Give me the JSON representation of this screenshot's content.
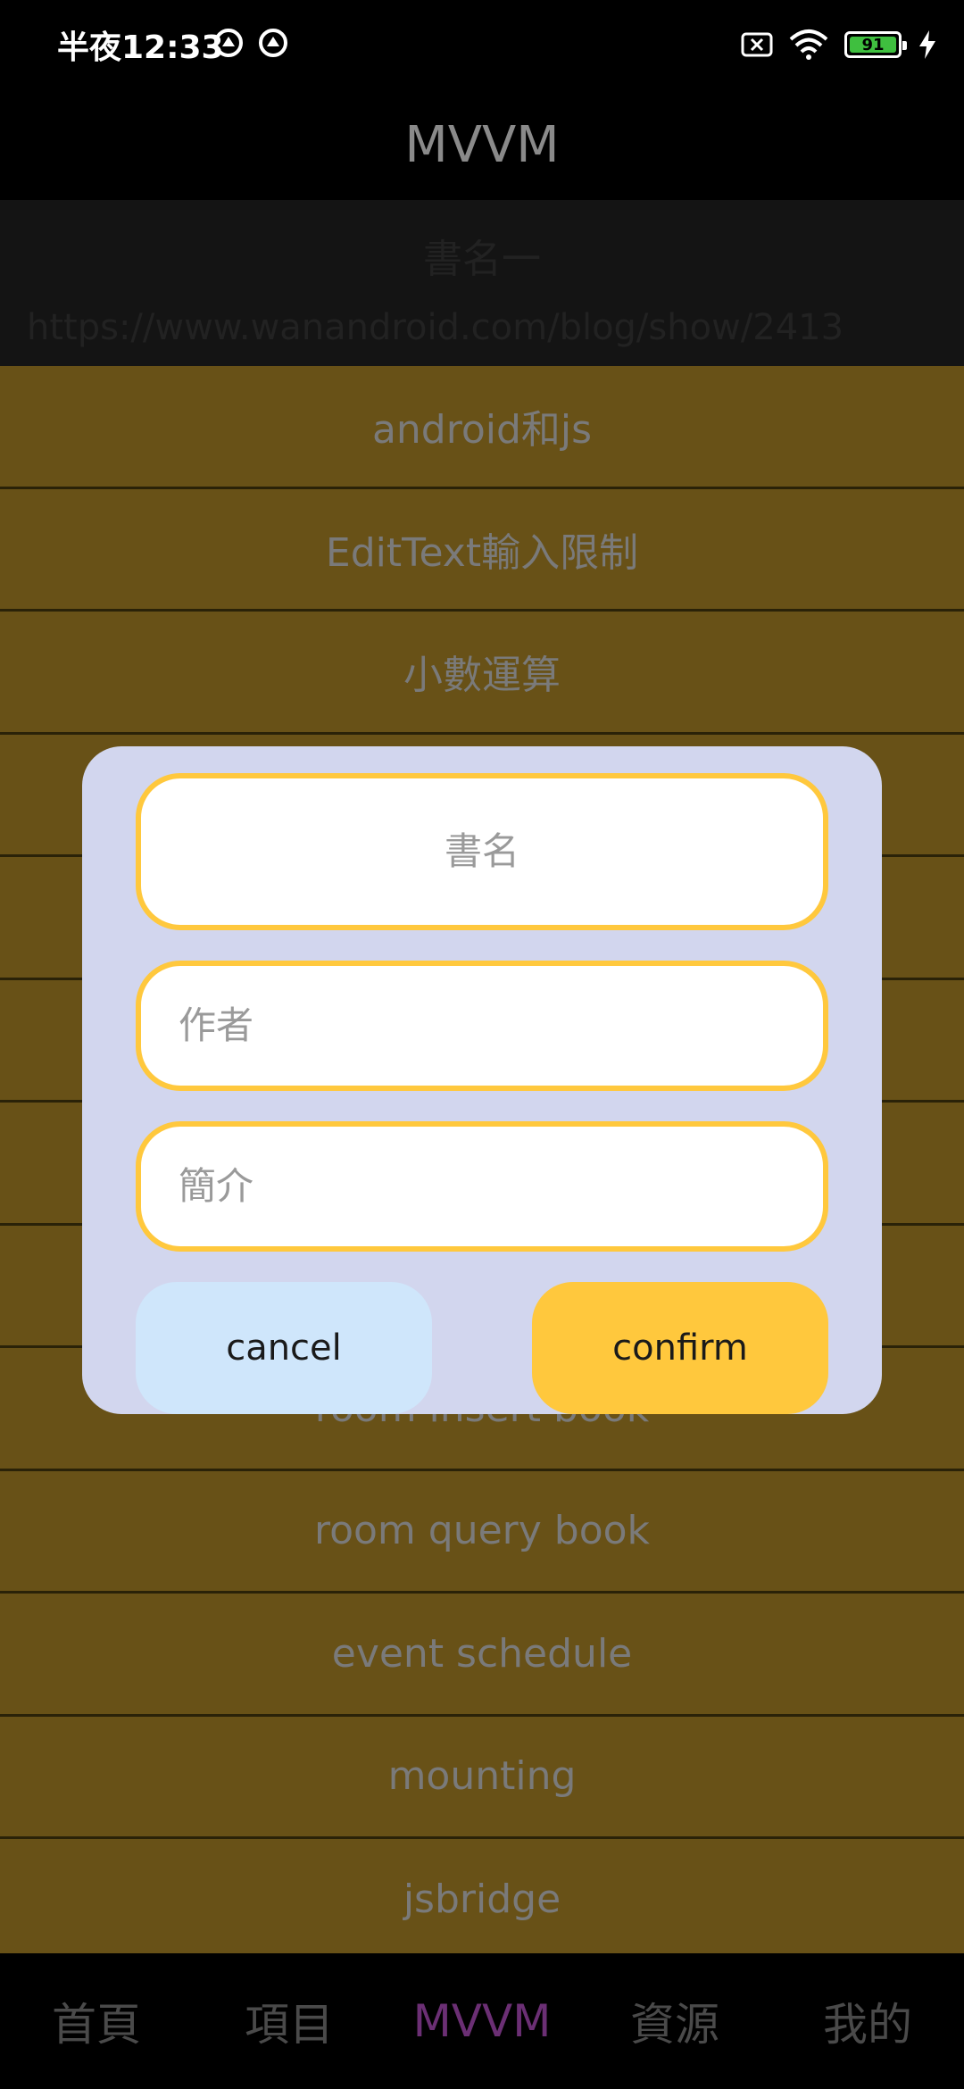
{
  "status_bar": {
    "time": "半夜12:33",
    "icons_left": [
      "vpn-icon",
      "vpn-icon"
    ],
    "icons_right": [
      "sim-off-icon",
      "wifi-icon",
      "battery-icon",
      "charging-icon"
    ],
    "battery_level": "91"
  },
  "app_bar": {
    "title": "MVVM"
  },
  "top_card": {
    "title": "書名一",
    "url": "https://www.wanandroid.com/blog/show/2413"
  },
  "list": {
    "items": [
      "android和js",
      "EditText輸入限制",
      "小數運算",
      "",
      "",
      "",
      "",
      "",
      "room insert book",
      "room query book",
      "event schedule",
      "mounting",
      "jsbridge"
    ]
  },
  "dialog": {
    "title_placeholder": "書名",
    "author_placeholder": "作者",
    "summary_placeholder": "簡介",
    "cancel_label": "cancel",
    "confirm_label": "confirm"
  },
  "bottom_nav": {
    "items": [
      "首頁",
      "項目",
      "MVVM",
      "資源",
      "我的"
    ],
    "active_index": 2
  },
  "colors": {
    "accent": "#ffc83d",
    "dialog_bg": "#d2d6ee",
    "cancel_bg": "#cfe6fb",
    "list_bg": "#685117",
    "nav_active": "#6b2f74"
  }
}
